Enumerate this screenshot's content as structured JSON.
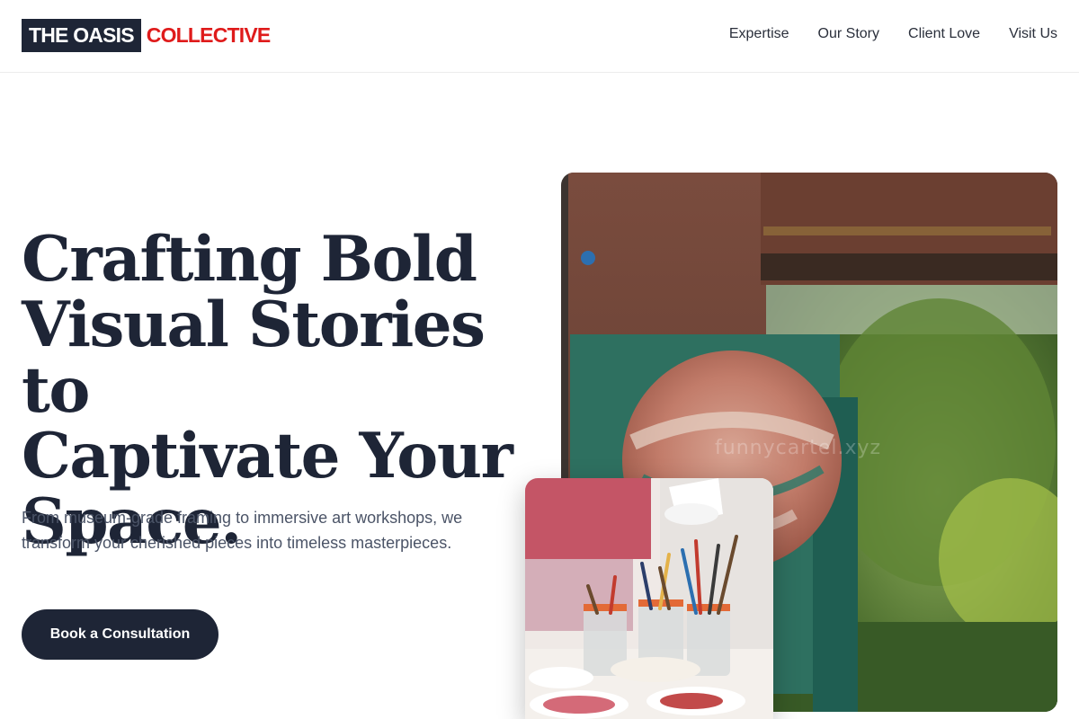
{
  "brand": {
    "name_box": "THE OASIS",
    "name_rest": "COLLECTIVE",
    "box_color": "#1e2536",
    "accent_color": "#df1b1b"
  },
  "nav": {
    "items": [
      "Expertise",
      "Our Story",
      "Client Love",
      "Visit Us"
    ]
  },
  "hero": {
    "headline_lines": [
      "Crafting Bold",
      "Visual Stories to",
      "Captivate Your",
      "Space."
    ],
    "subtitle": "From museum-grade framing to immersive art workshops, we transform your cherished pieces into timeless masterpieces.",
    "cta_label": "Book a Consultation",
    "watermark": "funnycartel.xyz"
  }
}
